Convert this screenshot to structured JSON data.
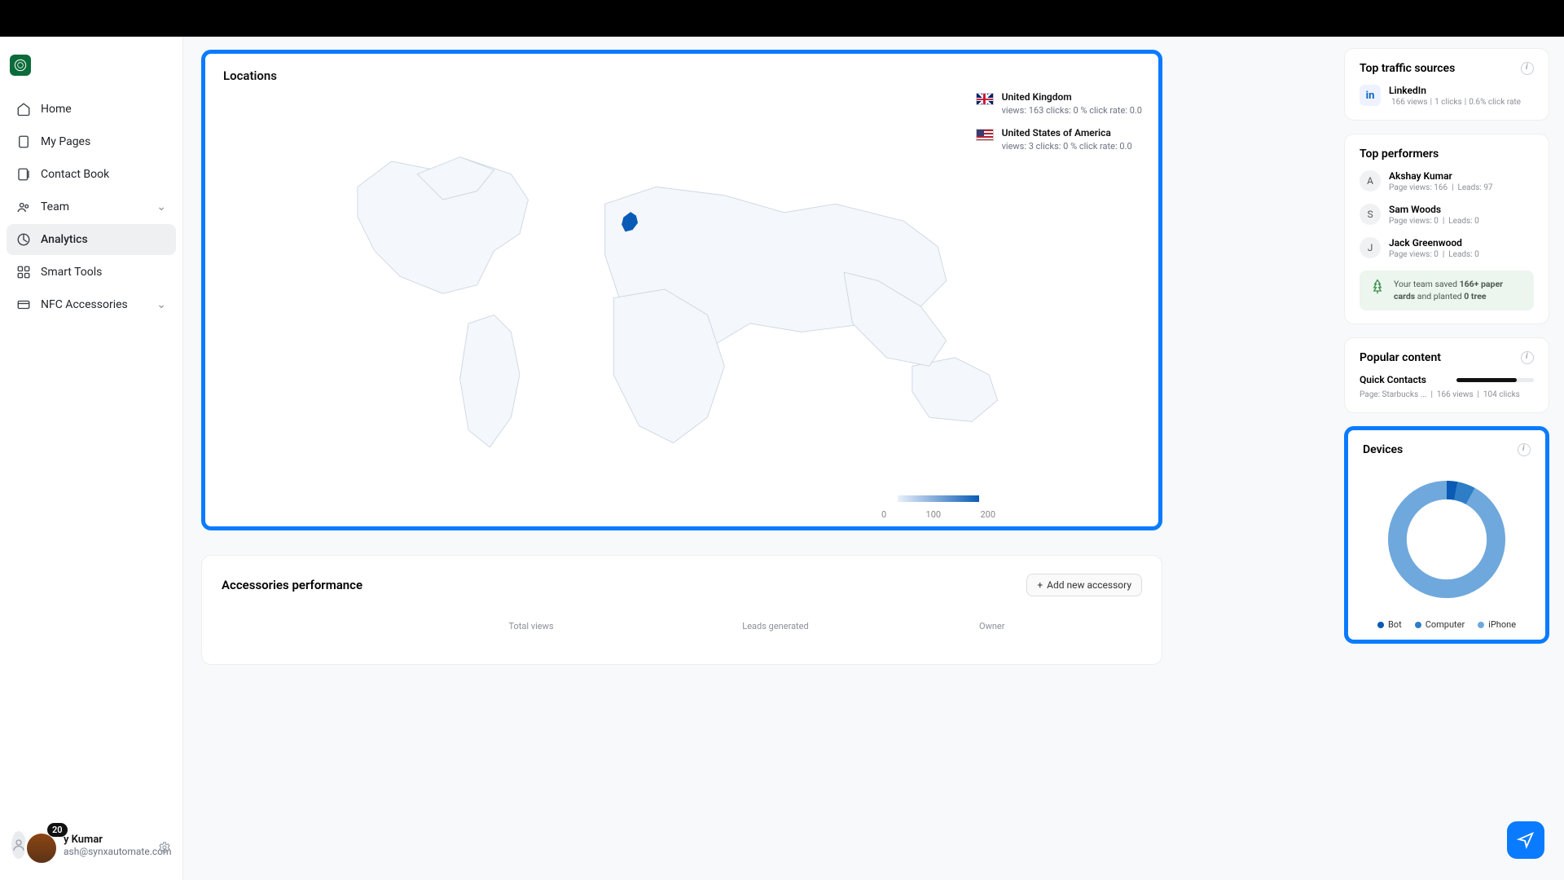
{
  "sidebar": {
    "items": [
      {
        "label": "Home"
      },
      {
        "label": "My Pages"
      },
      {
        "label": "Contact Book"
      },
      {
        "label": "Team"
      },
      {
        "label": "Analytics"
      },
      {
        "label": "Smart Tools"
      },
      {
        "label": "NFC Accessories"
      }
    ],
    "user": {
      "badge": "20",
      "name_suffix": "y Kumar",
      "email": "ash@synxautomate.com"
    }
  },
  "locations": {
    "title": "Locations",
    "countries": [
      {
        "name": "United Kingdom",
        "stats": "views: 163 clicks: 0 % click rate: 0.0"
      },
      {
        "name": "United States of America",
        "stats": "views: 3 clicks: 0 % click rate: 0.0"
      }
    ],
    "scale": {
      "min": "0",
      "mid": "100",
      "max": "200"
    }
  },
  "accessories": {
    "title": "Accessories performance",
    "add_label": "Add new accessory",
    "columns": [
      "",
      "Total views",
      "Leads generated",
      "Owner"
    ]
  },
  "traffic": {
    "title": "Top traffic sources",
    "source": {
      "name": "LinkedIn",
      "views": "166 views",
      "clicks": "1 clicks",
      "rate": "0.6% click rate"
    }
  },
  "performers": {
    "title": "Top performers",
    "rows": [
      {
        "initial": "A",
        "name": "Akshay Kumar",
        "views": "Page views: 166",
        "leads": "Leads: 97"
      },
      {
        "initial": "S",
        "name": "Sam Woods",
        "views": "Page views: 0",
        "leads": "Leads: 0"
      },
      {
        "initial": "J",
        "name": "Jack Greenwood",
        "views": "Page views: 0",
        "leads": "Leads: 0"
      }
    ],
    "banner": "Your team saved <b>166+ paper cards</b> and planted <b>0 tree</b>"
  },
  "popular": {
    "title": "Popular content",
    "item": "Quick Contacts",
    "sub_page": "Page: Starbucks ...",
    "sub_views": "166 views",
    "sub_clicks": "104 clicks"
  },
  "devices": {
    "title": "Devices",
    "legend": [
      "Bot",
      "Computer",
      "iPhone"
    ]
  },
  "chart_data": {
    "type": "pie",
    "title": "Devices",
    "categories": [
      "Bot",
      "Computer",
      "iPhone"
    ],
    "values": [
      3,
      5,
      92
    ],
    "colors": [
      "#0a5bb5",
      "#2d7ec7",
      "#6fa8dc"
    ]
  }
}
